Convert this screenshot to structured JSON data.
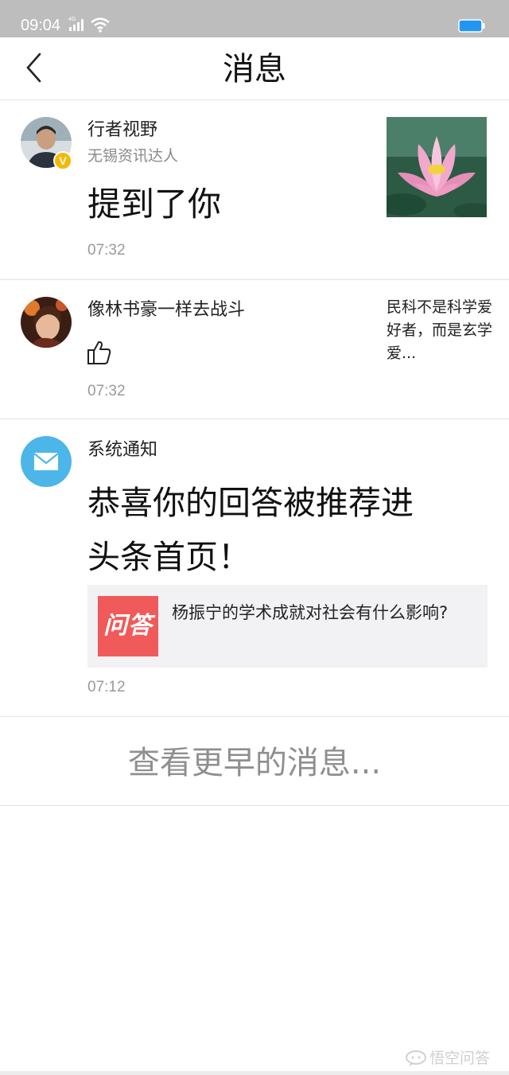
{
  "status_bar": {
    "time": "09:04",
    "network": "4G",
    "battery_color": "#2196f3"
  },
  "header": {
    "title": "消息",
    "back_icon": "chevron-left-icon"
  },
  "messages": [
    {
      "user": "行者视野",
      "badge": "V",
      "subtitle": "无锡资讯达人",
      "content": "提到了你",
      "time": "07:32",
      "thumbnail": "lotus-flower-image"
    },
    {
      "user": "像林书豪一样去战斗",
      "action_icon": "thumbs-up-icon",
      "time": "07:32",
      "side_text": "民科不是科学爱好者，而是玄学爱..."
    },
    {
      "user": "系统通知",
      "icon": "mail-icon",
      "content_line1": "恭喜你的回答被推荐进",
      "content_line2": "头条首页！",
      "quote": {
        "logo_text": "问答",
        "text": "杨振宁的学术成就对社会有什么影响?"
      },
      "time": "07:12"
    }
  ],
  "more": {
    "label": "查看更早的消息..."
  },
  "watermark": {
    "text": "悟空问答"
  },
  "colors": {
    "mail_blue": "#4db6e8",
    "badge_yellow": "#f5b800",
    "logo_red": "#f05a5a"
  }
}
